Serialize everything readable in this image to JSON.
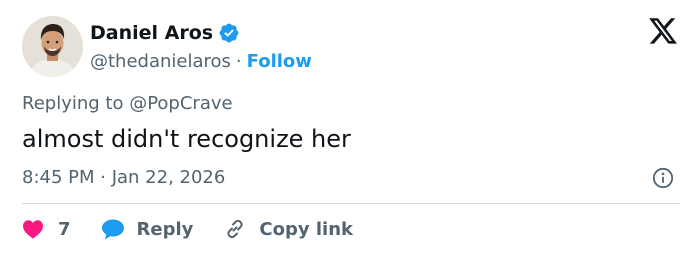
{
  "author": {
    "name": "Daniel Aros",
    "handle": "@thedanielaros",
    "separator": "·",
    "follow_label": "Follow"
  },
  "tweet": {
    "replying_to": "Replying to @PopCrave",
    "text": "almost didn't recognize her",
    "timestamp": "8:45 PM · Jan 22, 2026"
  },
  "actions": {
    "like_count": "7",
    "reply_label": "Reply",
    "copy_link_label": "Copy link"
  },
  "colors": {
    "accent": "#1d9bf0",
    "like": "#f91880",
    "secondary_text": "#536471",
    "primary_text": "#0f1419",
    "divider": "#cfd9de"
  },
  "icons": [
    "verified-badge-icon",
    "x-logo-icon",
    "info-icon",
    "heart-icon",
    "reply-bubble-icon",
    "link-icon"
  ]
}
